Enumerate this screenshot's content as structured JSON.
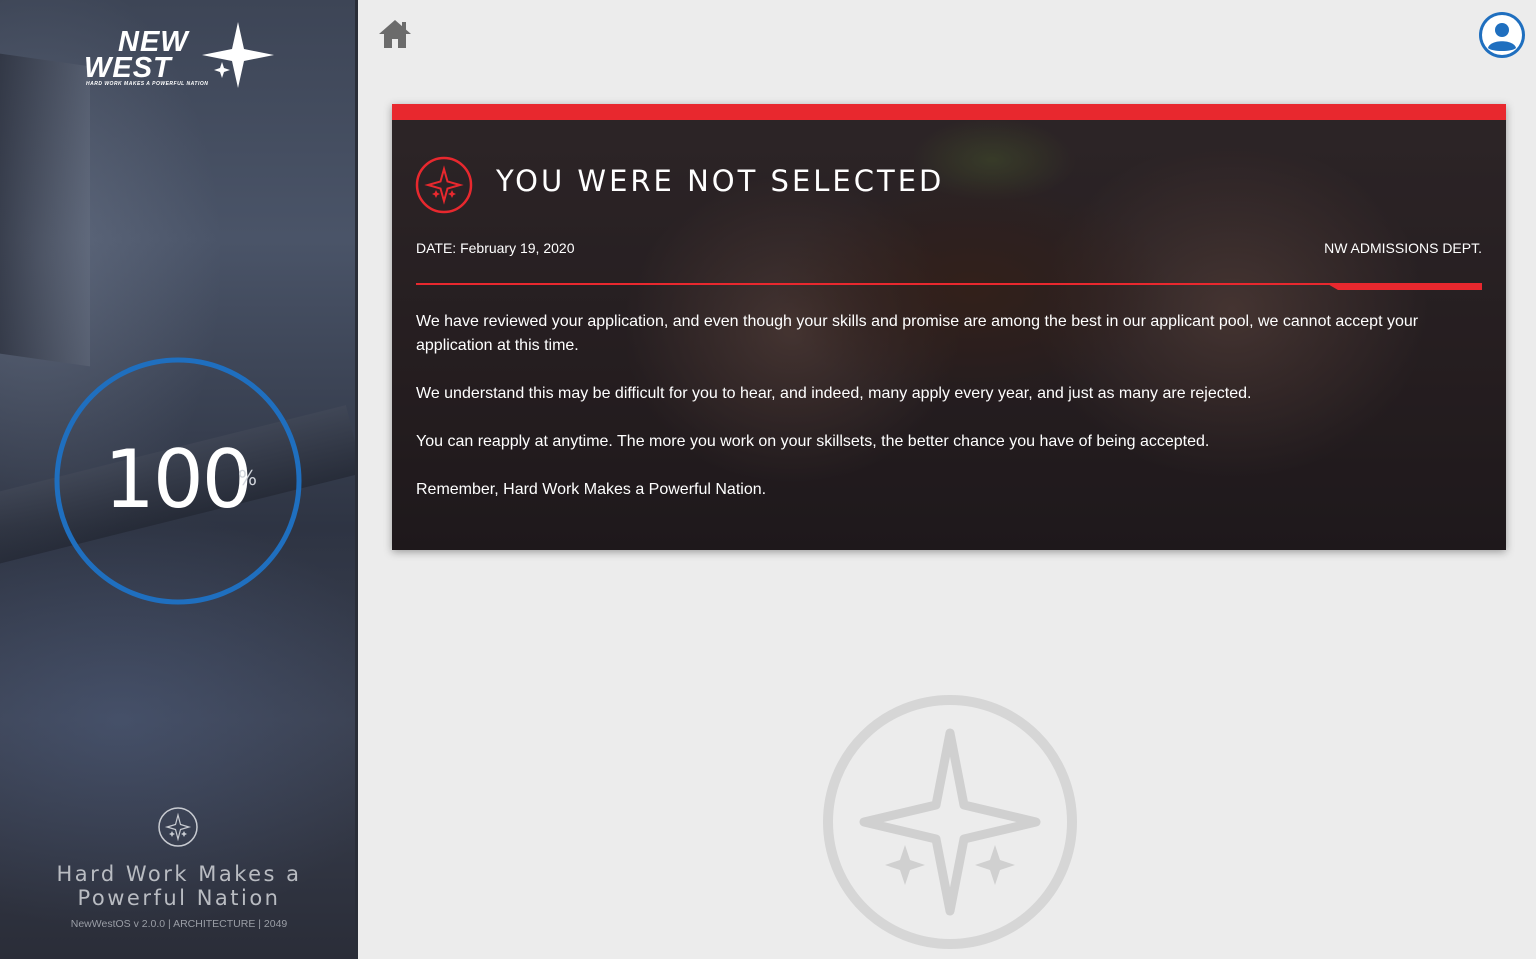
{
  "colors": {
    "accent_red": "#e8282e",
    "ring_blue": "#1f6fbf",
    "avatar_blue": "#1f6fbf"
  },
  "sidebar": {
    "logo": {
      "line1": "NEW",
      "line2": "WEST",
      "tagline": "HARD WORK MAKES A POWERFUL NATION"
    },
    "progress": {
      "value": 100,
      "value_text": "100",
      "unit": "%"
    },
    "motto": "Hard Work Makes a Powerful Nation",
    "version": "NewWestOS v 2.0.0  | ARCHITECTURE | 2049"
  },
  "header": {
    "home_icon": "home-icon",
    "account_icon": "user-avatar-icon"
  },
  "card": {
    "title": "YOU WERE NOT SELECTED",
    "date": "DATE: February 19, 2020",
    "department": "NW ADMISSIONS DEPT.",
    "messages": [
      "We have reviewed your application, and even though your skills and promise are among the best in our applicant pool, we cannot accept your application at this time.",
      "We understand this may be difficult for you to hear, and indeed, many apply every year, and just as many are rejected.",
      "You can reapply at anytime. The more you work on your skillsets, the better chance you have of being accepted.",
      "Remember, Hard Work Makes a Powerful Nation."
    ]
  }
}
